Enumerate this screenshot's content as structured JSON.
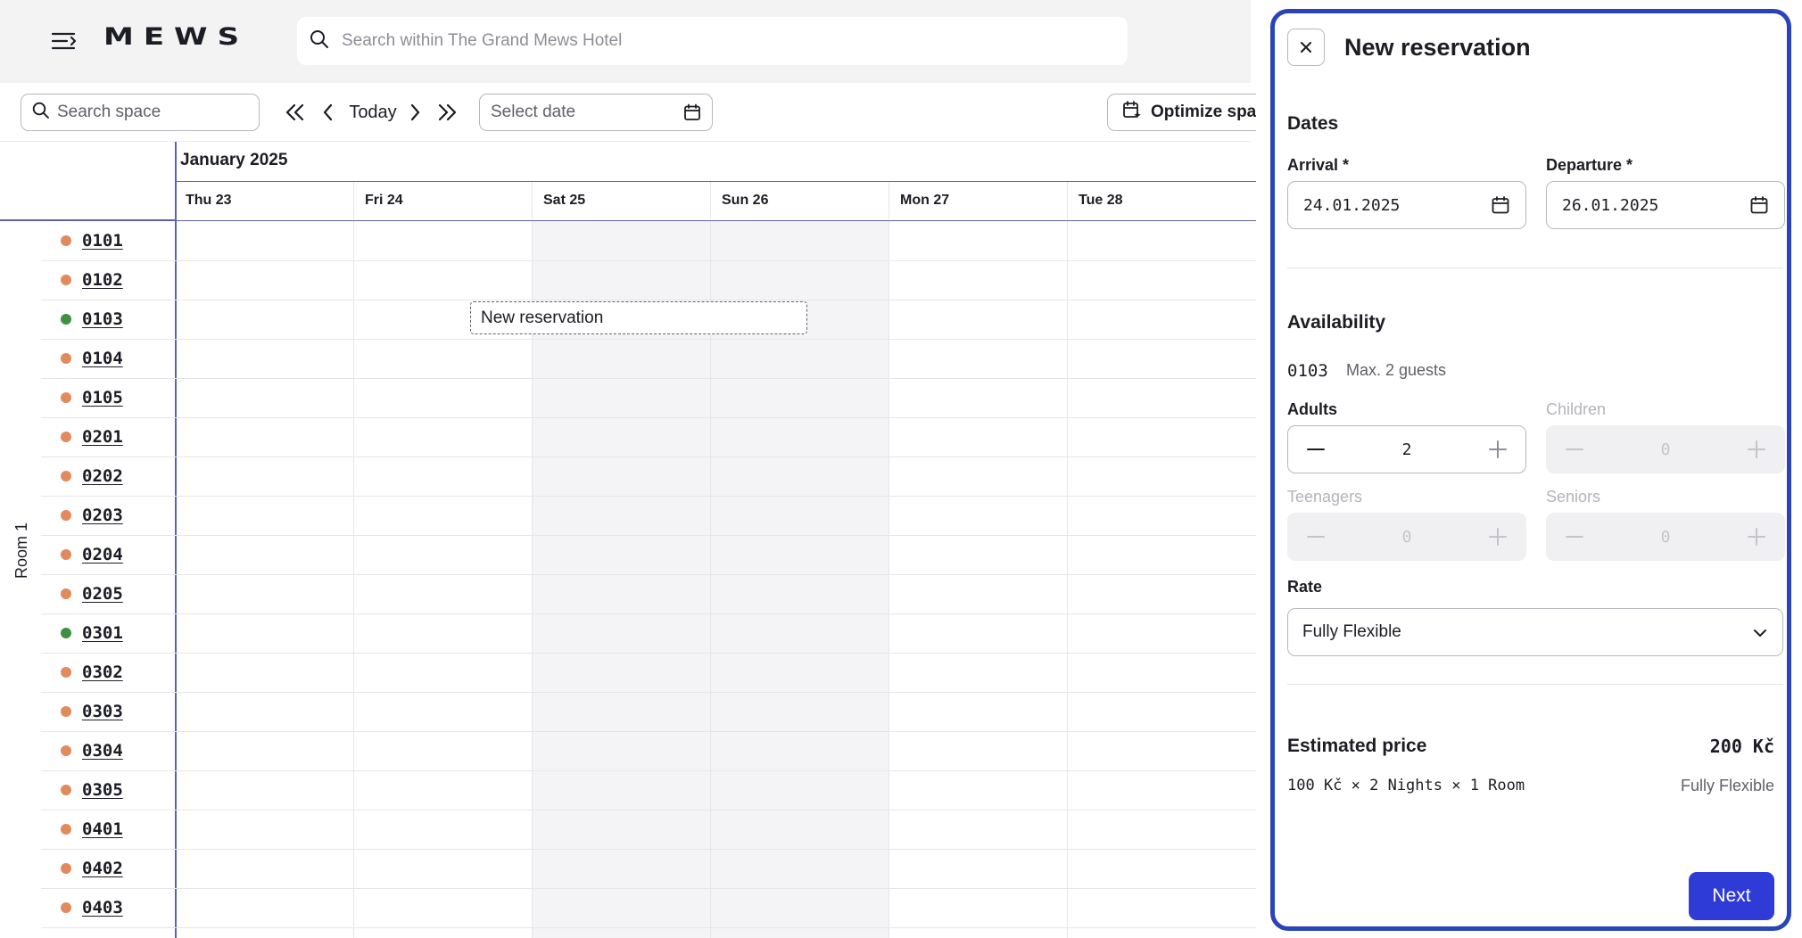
{
  "app": {
    "brand": "MEWS",
    "global_search_placeholder": "Search within The Grand Mews Hotel"
  },
  "toolbar": {
    "space_search_placeholder": "Search space",
    "today_label": "Today",
    "date_select_placeholder": "Select date",
    "optimize_label": "Optimize space"
  },
  "calendar": {
    "month": "January 2025",
    "days": [
      {
        "label": "Thu 23",
        "weekend": false
      },
      {
        "label": "Fri 24",
        "weekend": false
      },
      {
        "label": "Sat 25",
        "weekend": true
      },
      {
        "label": "Sun 26",
        "weekend": true
      },
      {
        "label": "Mon 27",
        "weekend": false
      },
      {
        "label": "Tue 28",
        "weekend": false
      }
    ],
    "group_label": "Room 1",
    "rooms": [
      {
        "code": "0101",
        "status_color": "#e08a5e"
      },
      {
        "code": "0102",
        "status_color": "#e08a5e"
      },
      {
        "code": "0103",
        "status_color": "#3f9142"
      },
      {
        "code": "0104",
        "status_color": "#e08a5e"
      },
      {
        "code": "0105",
        "status_color": "#e08a5e"
      },
      {
        "code": "0201",
        "status_color": "#e08a5e"
      },
      {
        "code": "0202",
        "status_color": "#e08a5e"
      },
      {
        "code": "0203",
        "status_color": "#e08a5e"
      },
      {
        "code": "0204",
        "status_color": "#e08a5e"
      },
      {
        "code": "0205",
        "status_color": "#e08a5e"
      },
      {
        "code": "0301",
        "status_color": "#3f9142"
      },
      {
        "code": "0302",
        "status_color": "#e08a5e"
      },
      {
        "code": "0303",
        "status_color": "#e08a5e"
      },
      {
        "code": "0304",
        "status_color": "#e08a5e"
      },
      {
        "code": "0305",
        "status_color": "#e08a5e"
      },
      {
        "code": "0401",
        "status_color": "#e08a5e"
      },
      {
        "code": "0402",
        "status_color": "#e08a5e"
      },
      {
        "code": "0403",
        "status_color": "#e08a5e"
      }
    ],
    "new_reservation_block": "New reservation"
  },
  "panel": {
    "title": "New reservation",
    "dates_title": "Dates",
    "arrival_label": "Arrival *",
    "arrival_value": "24.01.2025",
    "departure_label": "Departure *",
    "departure_value": "26.01.2025",
    "availability_title": "Availability",
    "availability_room": "0103",
    "availability_max": "Max. 2 guests",
    "adults_label": "Adults",
    "adults_value": "2",
    "children_label": "Children",
    "children_value": "0",
    "teenagers_label": "Teenagers",
    "teenagers_value": "0",
    "seniors_label": "Seniors",
    "seniors_value": "0",
    "rate_label": "Rate",
    "rate_value": "Fully Flexible",
    "estimated_price_title": "Estimated price",
    "estimated_price_value": "200 Kč",
    "price_breakdown": "100 Kč × 2 Nights × 1 Room",
    "price_rate": "Fully Flexible",
    "next_label": "Next"
  },
  "colors": {
    "accent": "#2f3bd6",
    "panel_border": "#2a44b8",
    "header_line": "#5f62a8",
    "weekend_bg": "#f4f4f7"
  }
}
